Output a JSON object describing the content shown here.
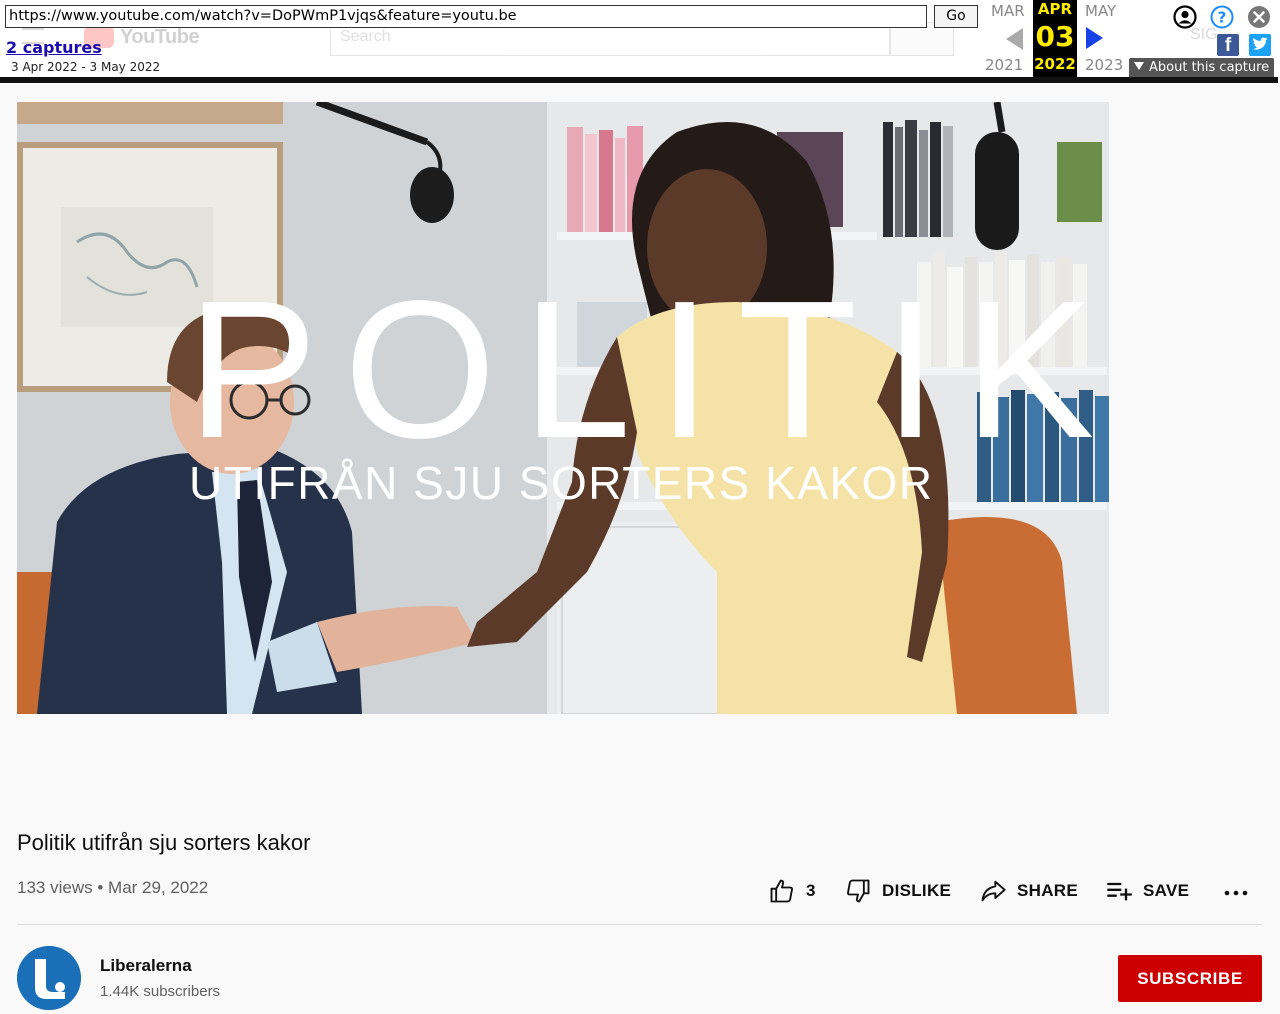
{
  "wayback": {
    "url": "https://www.youtube.com/watch?v=DoPWmP1vjqs&feature=youtu.be",
    "go_label": "Go",
    "captures_link": "2 captures",
    "capture_range": "3 Apr 2022 - 3 May 2022",
    "prev_month": "MAR",
    "current_month": "APR",
    "next_month": "MAY",
    "current_day": "03",
    "prev_year": "2021",
    "current_year": "2022",
    "next_year": "2023",
    "about_label": "About this capture"
  },
  "youtube_ghost": {
    "logo_text": "YouTube",
    "search_placeholder": "Search",
    "sign_in": "SIG"
  },
  "video": {
    "overlay_title": "POLITIK",
    "overlay_subtitle": "UTIFRÅN SJU SORTERS KAKOR",
    "title": "Politik utifrån sju sorters kakor",
    "views": "133 views",
    "separator": "•",
    "date": "Mar 29, 2022"
  },
  "actions": {
    "like_count": "3",
    "dislike_label": "DISLIKE",
    "share_label": "SHARE",
    "save_label": "SAVE"
  },
  "channel": {
    "name": "Liberalerna",
    "subscribers": "1.44K subscribers",
    "subscribe_label": "SUBSCRIBE"
  },
  "colors": {
    "subscribe": "#cc0000",
    "wayback_highlight": "#ffeb00",
    "avatar": "#1b6fb8"
  }
}
